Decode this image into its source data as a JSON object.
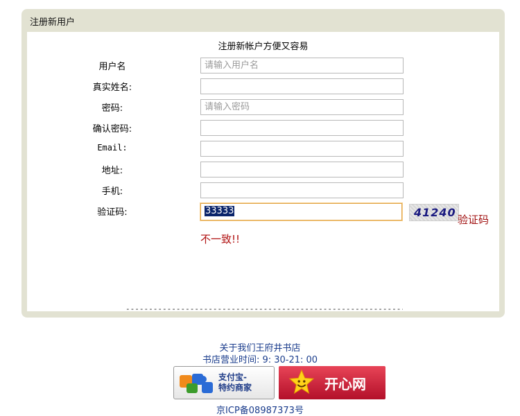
{
  "panel": {
    "title": "注册新用户"
  },
  "form": {
    "subtitle": "注册新帐户方便又容易",
    "fields": [
      {
        "label": "用户名",
        "value": "",
        "placeholder": "请输入用户名"
      },
      {
        "label": "真实姓名:",
        "value": "",
        "placeholder": ""
      },
      {
        "label": "密码:",
        "value": "",
        "placeholder": "请输入密码"
      },
      {
        "label": "确认密码:",
        "value": "",
        "placeholder": ""
      },
      {
        "label": "Email:",
        "value": "",
        "placeholder": ""
      },
      {
        "label": "地址:",
        "value": "",
        "placeholder": ""
      },
      {
        "label": "手机:",
        "value": "",
        "placeholder": ""
      },
      {
        "label": "验证码:",
        "value": "33333",
        "placeholder": ""
      }
    ],
    "captcha_image_text": "41240",
    "captcha_link": "验证码",
    "error": "不一致!!",
    "divider": "----------------------------------------------------------------"
  },
  "footer": {
    "about": "关于我们王府井书店",
    "hours": "书店营业时间: 9: 30-21: 00",
    "alipay_badge": "支付宝-特约商家",
    "alipay_line1": "支付宝-",
    "alipay_line2": "特约商家",
    "happy_badge": "开心网",
    "icp": "京ICP备08987373号"
  },
  "colors": {
    "panel_bg": "#e2e2d2",
    "link_blue": "#1a3c8c",
    "error_red": "#b01010",
    "focus_border": "#e2a64a",
    "happy_red": "#d0213a"
  }
}
